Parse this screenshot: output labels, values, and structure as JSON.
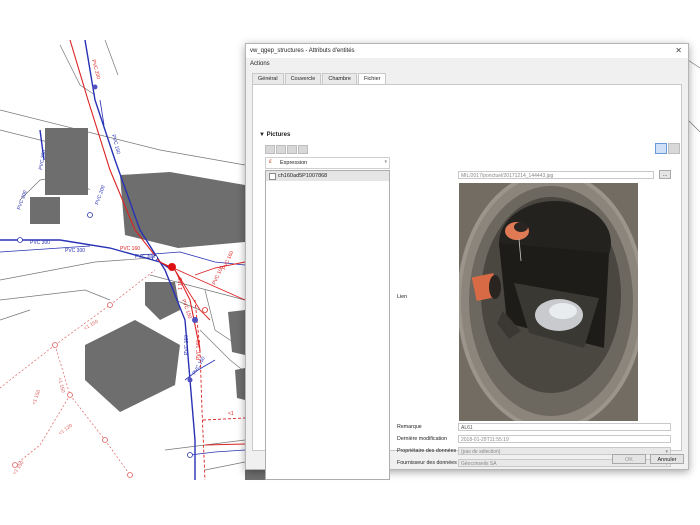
{
  "map": {
    "labels": [
      "PVC 300",
      "PVC 200",
      "PVC 300",
      "PVC 300",
      "PVC 200",
      "PVC 150",
      "PVC 200",
      "PVC 160",
      "PVC 150",
      "PVC 150",
      "PVC 150",
      "PVC 100",
      "PVC 160",
      "PVC 300",
      "<1 150",
      "<1 150",
      "<1 150",
      "<1 120",
      "<1 150",
      "PVC 160",
      "1 150",
      "<1"
    ]
  },
  "dialog": {
    "title": "vw_qgep_structures - Attributs d'entités",
    "close_icon": "close-icon",
    "actions_label": "Actions",
    "tabs": [
      "Général",
      "Couvercle",
      "Chambre",
      "Fichier"
    ],
    "active_tab": "Fichier",
    "section_title": "Pictures",
    "expression_label": "Expression",
    "list_items": [
      "ch160ad5P1007868"
    ],
    "lien_label": "Lien",
    "file_path": "MIL/2017/ponctuel/20171214_144443.jpg",
    "browse_label": "...",
    "fields": [
      {
        "label": "Remarque",
        "value": "AL61"
      },
      {
        "label": "Dernière modification",
        "value": "2018-01-29T11:55:19"
      },
      {
        "label": "Propriétaire des données",
        "value": "(pas de sélection)"
      },
      {
        "label": "Fournisseur des données",
        "value": "Géoconseils SA"
      }
    ],
    "ok_label": "OK",
    "cancel_label": "Annuler"
  }
}
